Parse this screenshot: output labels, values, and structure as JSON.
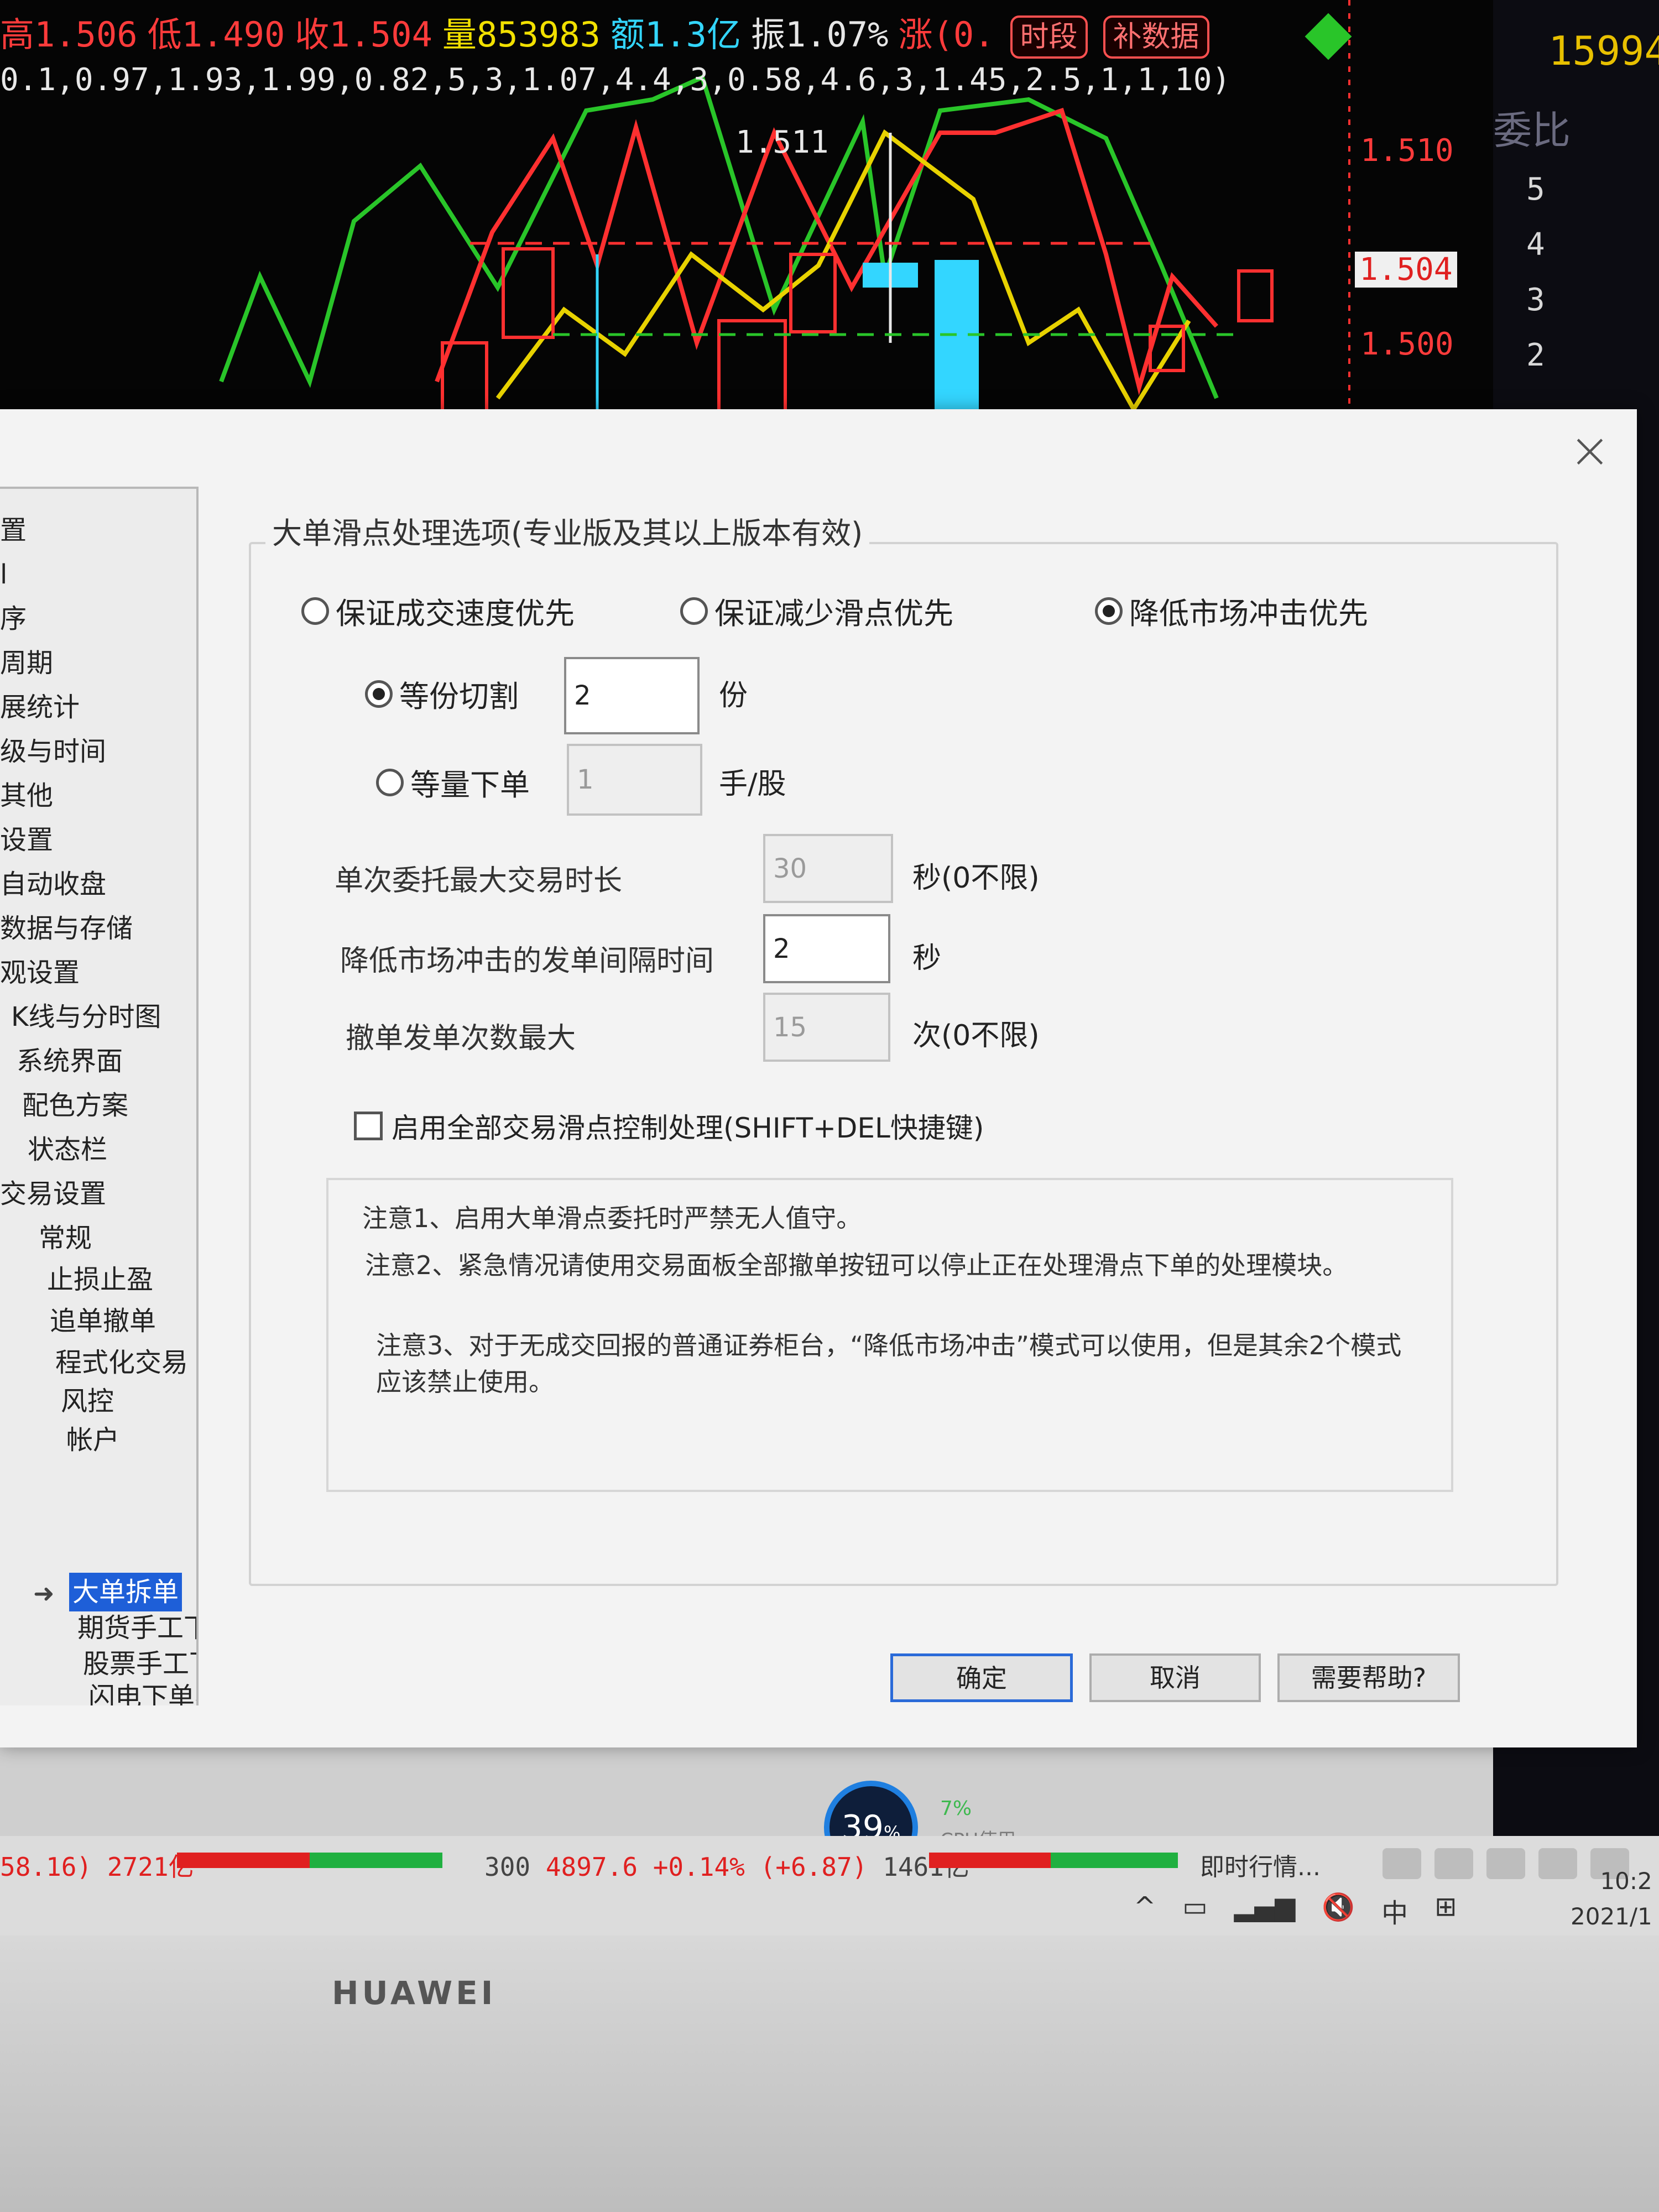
{
  "chart": {
    "high": "高1.506",
    "low": "低1.490",
    "close": "收1.504",
    "volume": "量853983",
    "amount": "额1.3亿",
    "amplitude": "振1.07%",
    "change": "涨(0.",
    "btn_period": "时段",
    "btn_supplement": "补数据",
    "params": "0.1,0.97,1.93,1.99,0.82,5,3,1.07,4.4,3,0.58,4.6,3,1.45,2.5,1,1,10)",
    "price_top": "1.511",
    "price_hi": "1.510",
    "price_mid": "1.504",
    "price_low": "1.500"
  },
  "right_panel": {
    "top_value": "15994",
    "label": "委比",
    "levels": [
      "5",
      "4",
      "3",
      "2"
    ]
  },
  "dialog": {
    "group_title": "大单滑点处理选项(专业版及其以上版本有效)",
    "radio_speed": "保证成交速度优先",
    "radio_slippage": "保证减少滑点优先",
    "radio_impact": "降低市场冲击优先",
    "radio_equal_split": "等份切割",
    "equal_split_value": "2",
    "equal_split_unit": "份",
    "radio_equal_qty": "等量下单",
    "equal_qty_value": "1",
    "equal_qty_unit": "手/股",
    "max_duration_label": "单次委托最大交易时长",
    "max_duration_value": "30",
    "max_duration_unit": "秒(0不限)",
    "interval_label": "降低市场冲击的发单间隔时间",
    "interval_value": "2",
    "interval_unit": "秒",
    "max_cancel_label": "撤单发单次数最大",
    "max_cancel_value": "15",
    "max_cancel_unit": "次(0不限)",
    "enable_all_label": "启用全部交易滑点控制处理(SHIFT+DEL快捷键)",
    "note1": "注意1、启用大单滑点委托时严禁无人值守。",
    "note2": "注意2、紧急情况请使用交易面板全部撤单按钮可以停止正在处理滑点下单的处理模块。",
    "note3": "注意3、对于无成交回报的普通证券柜台，“降低市场冲击”模式可以使用，但是其余2个模式应该禁止使用。",
    "ok": "确定",
    "cancel": "取消",
    "help": "需要帮助?"
  },
  "tree": {
    "items": [
      "置",
      "l",
      "序",
      "周期",
      "展统计",
      "级与时间",
      "其他",
      "设置",
      "自动收盘",
      "数据与存储",
      "观设置",
      "K线与分时图",
      "系统界面",
      "配色方案",
      "状态栏",
      "交易设置",
      "常规",
      "止损止盈",
      "追单撤单",
      "程式化交易",
      "风控",
      "帐户",
      "大单拆单",
      "期货手工下单",
      "股票手工下单",
      "闪电下单界面"
    ],
    "selected_index": 22
  },
  "taskbar": {
    "ticker_left": "58.16) 2721亿",
    "ticker_index": "300",
    "ticker_value": "4897.6 +0.14% (+6.87)",
    "ticker_amount": "1461亿",
    "app_label": "即时行情...",
    "ime": "中",
    "time": "10:2",
    "date": "2021/1"
  },
  "cpu": {
    "percent": "39",
    "unit": "%",
    "usage_value": "7%",
    "usage_label": "CPU使用"
  },
  "laptop": {
    "brand": "HUAWEI"
  }
}
